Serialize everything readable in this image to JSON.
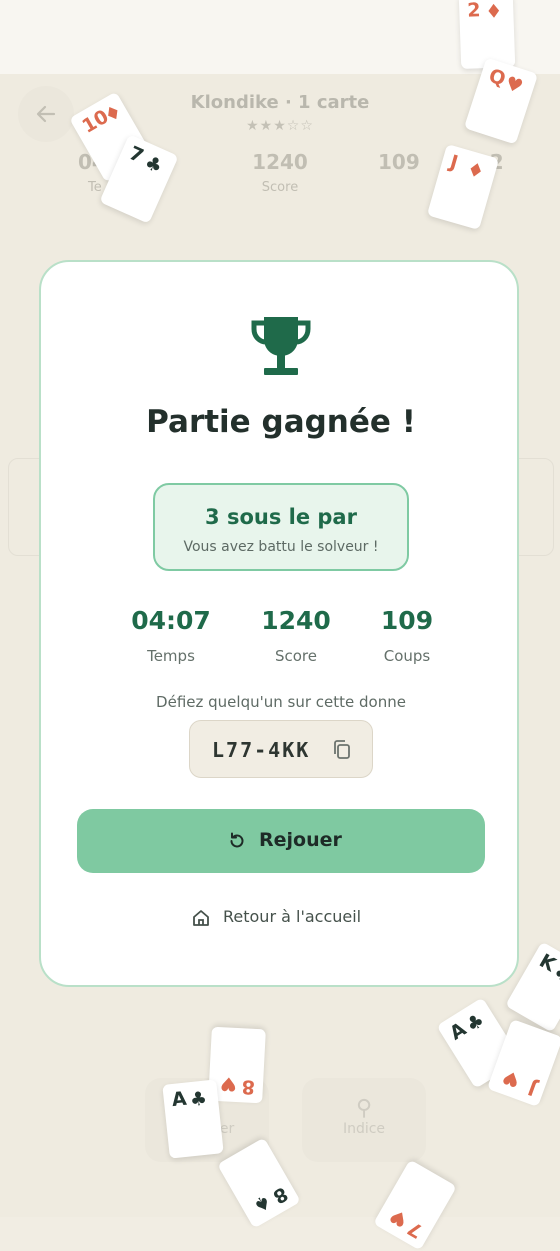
{
  "game": {
    "title": "Klondike · 1 carte",
    "stars": "★★★☆☆",
    "stats": [
      {
        "value": "04",
        "label": "Te"
      },
      {
        "value": "1240",
        "label": "Score"
      },
      {
        "value": "109",
        "label": "2"
      }
    ],
    "bottom_buttons": [
      {
        "label": "Annuler",
        "icon": "undo-icon"
      },
      {
        "label": "Indice",
        "icon": "lightbulb-icon"
      }
    ]
  },
  "modal": {
    "title": "Partie gagnée !",
    "par": {
      "main": "3 sous le par",
      "sub": "Vous avez battu le solveur !"
    },
    "stats": [
      {
        "value": "04:07",
        "label": "Temps"
      },
      {
        "value": "1240",
        "label": "Score"
      },
      {
        "value": "109",
        "label": "Coups"
      }
    ],
    "challenge_text": "Défiez quelqu'un sur cette donne",
    "code": "L77-4KK",
    "replay_label": "Rejouer",
    "home_label": "Retour à l'accueil"
  },
  "cards": [
    {
      "rank": "2",
      "suit": "♦"
    },
    {
      "rank": "Q",
      "suit": "♥"
    },
    {
      "rank": "10",
      "suit": "♦"
    },
    {
      "rank": "7",
      "suit": "♣"
    },
    {
      "rank": "J",
      "suit": "♦"
    },
    {
      "rank": "K",
      "suit": "♣"
    },
    {
      "rank": "A",
      "suit": "♣"
    },
    {
      "rank": "J",
      "suit": "♥"
    },
    {
      "rank": "8",
      "suit": "♥"
    },
    {
      "rank": "A",
      "suit": "♣"
    },
    {
      "rank": "8",
      "suit": "♠"
    },
    {
      "rank": "7",
      "suit": "♥"
    }
  ],
  "colors": {
    "accent": "#1f6a4a",
    "button": "#7fc9a1",
    "card_red": "#dc6a4e",
    "card_black": "#233631"
  }
}
